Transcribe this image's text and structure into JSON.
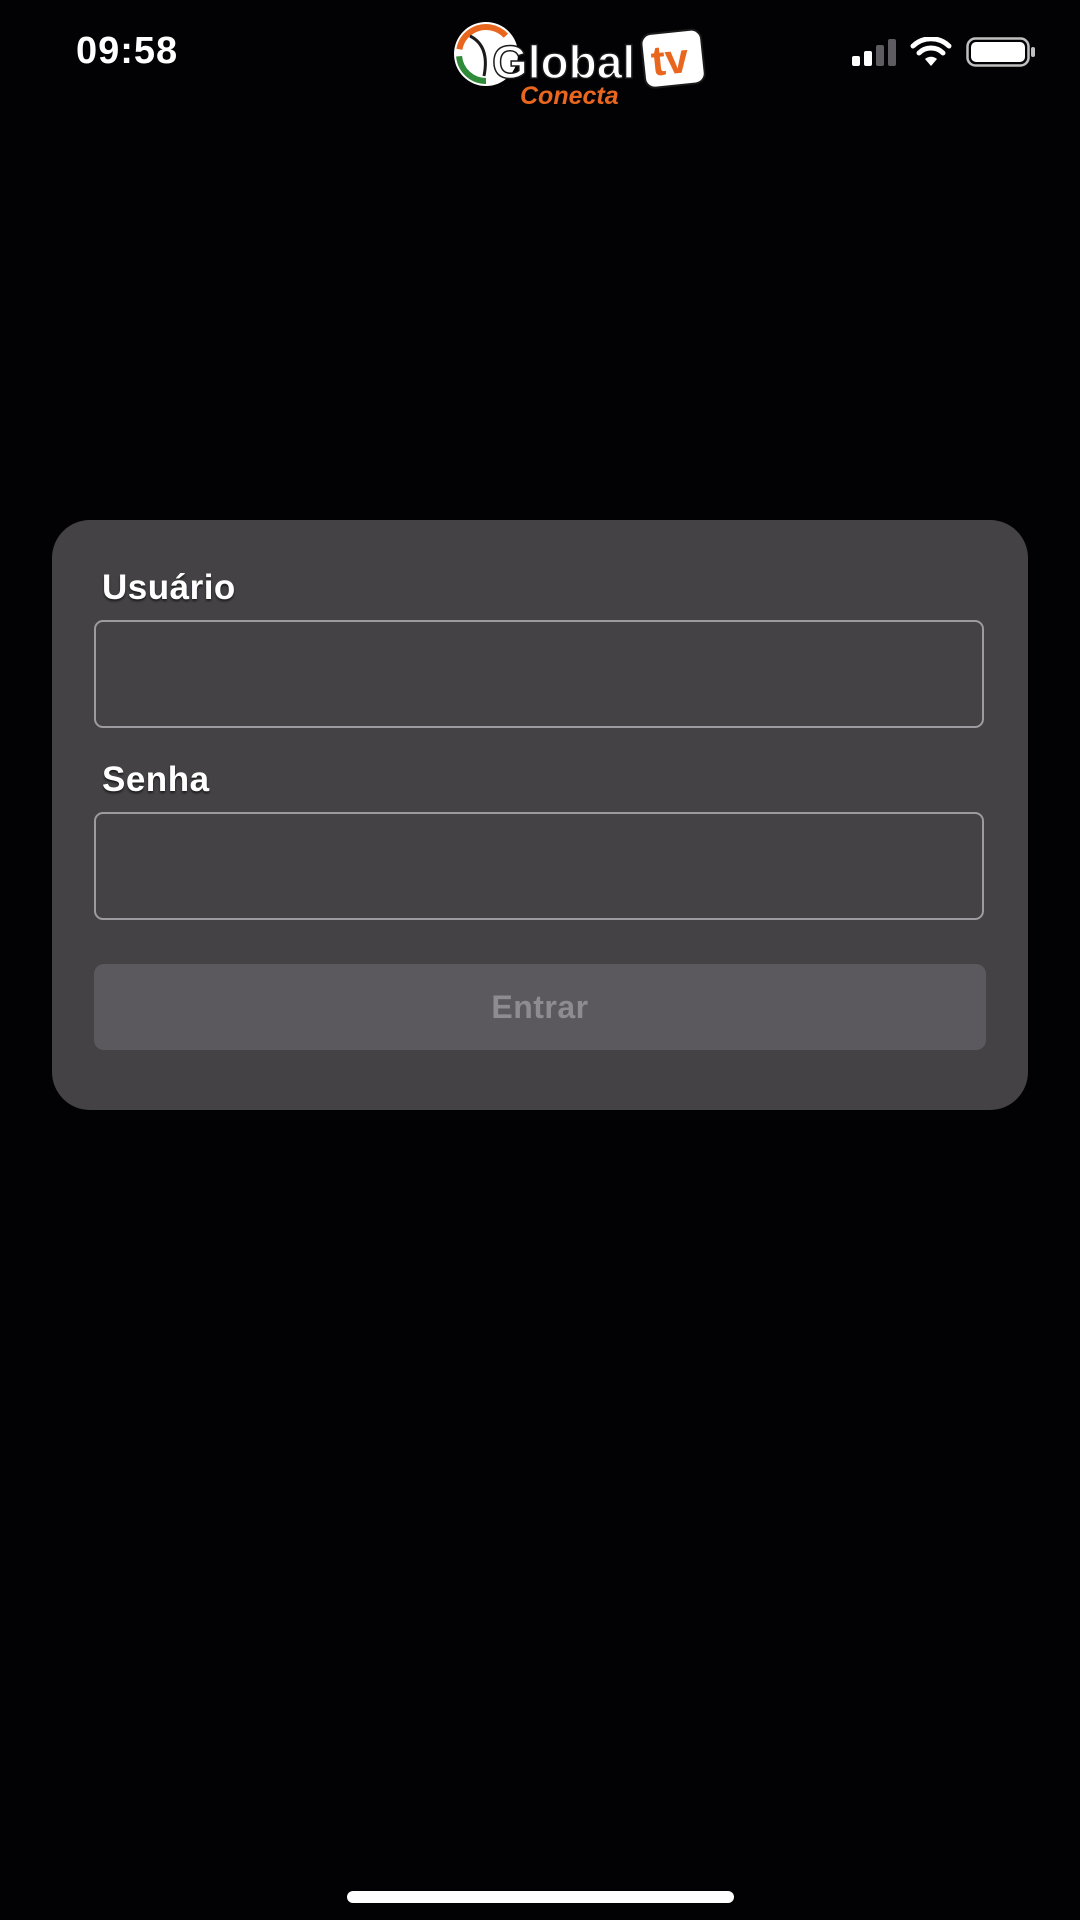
{
  "status_bar": {
    "time": "09:58",
    "icons": [
      "cellular-signal-icon",
      "wifi-icon",
      "battery-icon"
    ],
    "signal_strength": 0.5
  },
  "logo": {
    "brand": "Global",
    "tagline": "Conecta",
    "badge": "tv",
    "colors": {
      "orange": "#e8661e",
      "green": "#2f8a3a",
      "white": "#ffffff"
    }
  },
  "login": {
    "username_label": "Usuário",
    "username_value": "",
    "password_label": "Senha",
    "password_value": "",
    "submit_label": "Entrar"
  },
  "colors": {
    "background": "#020103",
    "card": "#444245",
    "input_border": "#9d9ba0",
    "button_bg": "#5b595d",
    "button_text": "#8e8c90"
  }
}
